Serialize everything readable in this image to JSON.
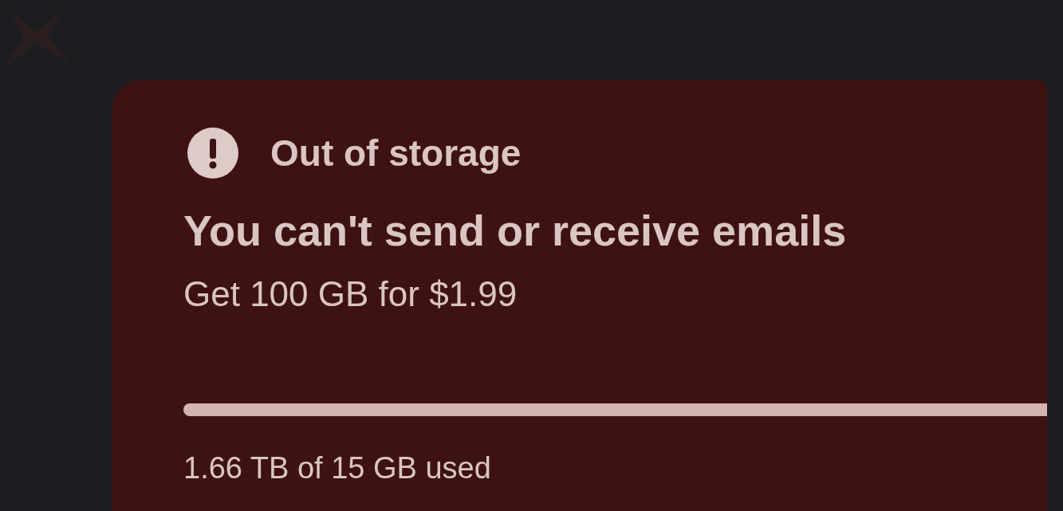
{
  "alert": {
    "title": "Out of storage",
    "heading": "You can't send or receive emails",
    "offer": "Get 100 GB for $1.99",
    "storage": {
      "level": 1,
      "reading": "1.66 TB of 15 GB used"
    }
  }
}
